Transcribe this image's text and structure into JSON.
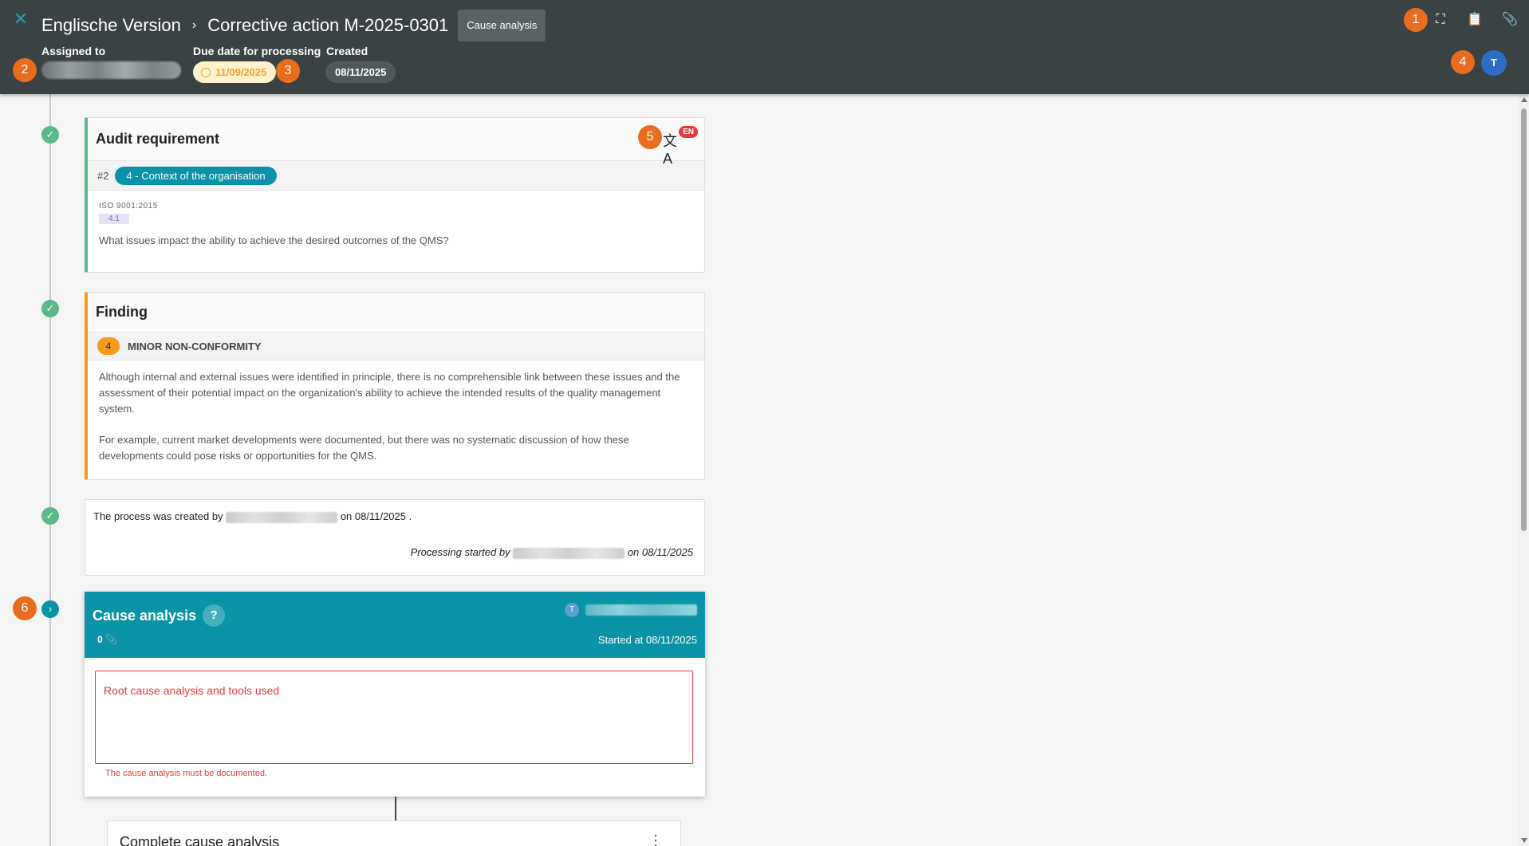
{
  "header": {
    "title": "Englische Version",
    "subtitle": "Corrective action M-2025-0301",
    "stage_chip": "Cause analysis",
    "assigned_label": "Assigned to",
    "due_label": "Due date for processing",
    "due_value": "11/09/2025",
    "created_label": "Created",
    "created_value": "08/11/2025",
    "avatar_initial": "T"
  },
  "badges": {
    "b1": "1",
    "b2": "2",
    "b3": "3",
    "b4": "4",
    "b5": "5",
    "b6": "6"
  },
  "audit": {
    "title": "Audit requirement",
    "lang_badge": "EN",
    "number": "#2",
    "chapter": "4 - Context of the organisation",
    "standard": "ISO 9001:2015",
    "clause": "4.1",
    "question": "What issues impact the ability to achieve the desired outcomes of the QMS?"
  },
  "finding": {
    "title": "Finding",
    "level": "4",
    "type": "MINOR NON-CONFORMITY",
    "para1": "Although internal and external issues were identified in principle, there is no comprehensible link between these issues and the assessment of their potential impact on the organization's ability to achieve the intended results of the quality management system.",
    "para2": "For example, current market developments were documented, but there was no systematic discussion of how these developments could pose risks or opportunities for the QMS."
  },
  "process": {
    "created_prefix": "The process was created by",
    "created_suffix": "on 08/11/2025 .",
    "started_prefix": "Processing started by",
    "started_suffix": "on 08/11/2025"
  },
  "cause": {
    "title": "Cause analysis",
    "help": "?",
    "attachments": "0",
    "user_initial": "T",
    "started": "Started at 08/11/2025",
    "placeholder": "Root cause analysis and tools used",
    "error": "The cause analysis must be documented."
  },
  "next_step": {
    "title": "Complete cause analysis"
  },
  "colors": {
    "header_bg": "#3b4244",
    "accent": "#0a93a6",
    "badge": "#e86d1e",
    "error": "#e23b3b",
    "success": "#5cb88a"
  }
}
